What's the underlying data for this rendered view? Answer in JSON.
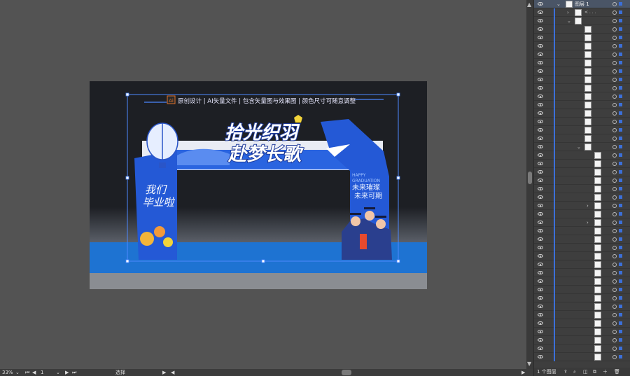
{
  "statusbar": {
    "zoom": "33%",
    "artboard_num": "1",
    "tool": "选择"
  },
  "banner": "原创设计 | AI矢量文件 | 包含矢量图与效果图 | 颜色尺寸可随意调整",
  "ai_badge": "Ai",
  "title_line1": "拾光织羽",
  "title_line2": "赴梦长歌",
  "side_text_line1": "我们",
  "side_text_line2": "毕业啦",
  "happy": "HAPPY",
  "graduation": "GRADUATION",
  "slogan1": "未来璀璨",
  "slogan2": "未来可期",
  "layers": {
    "top_layer": "图层 1",
    "sub1": "< . . .",
    "footer_count": "1 个图层"
  },
  "colors": {
    "accent": "#3b6fd8",
    "arch_blue": "#1e4fc7",
    "stage_blue": "#1e73d2",
    "dark_bg": "#1d1f24"
  }
}
